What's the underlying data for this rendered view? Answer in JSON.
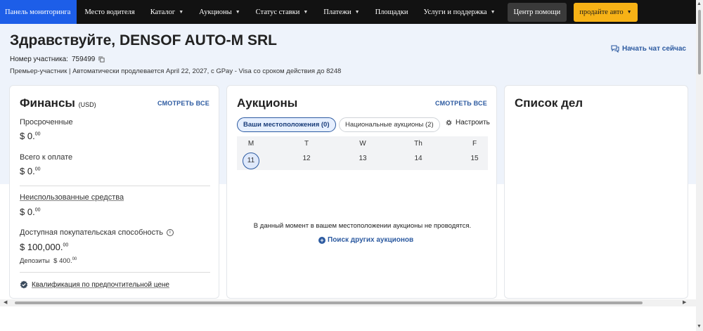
{
  "nav": {
    "items": [
      {
        "label": "Панель мониторинга",
        "active": true,
        "dropdown": false
      },
      {
        "label": "Место водителя",
        "active": false,
        "dropdown": false
      },
      {
        "label": "Каталог",
        "active": false,
        "dropdown": true
      },
      {
        "label": "Аукционы",
        "active": false,
        "dropdown": true
      },
      {
        "label": "Статус ставки",
        "active": false,
        "dropdown": true
      },
      {
        "label": "Платежи",
        "active": false,
        "dropdown": true
      },
      {
        "label": "Площадки",
        "active": false,
        "dropdown": false
      },
      {
        "label": "Услуги и поддержка",
        "active": false,
        "dropdown": true
      }
    ],
    "help_label": "Центр помощи",
    "sell_label": "продайте авто"
  },
  "header": {
    "greeting": "Здравствуйте, DENSOF AUTO-M SRL",
    "member_label": "Номер участника:",
    "member_number": "759499",
    "premier_line": "Премьер-участник  |  Автоматически продлевается April 22, 2027, с GPay - Visa со сроком действия до 8248",
    "chat_label": "Начать чат сейчас"
  },
  "finance": {
    "title": "Финансы",
    "currency": "(USD)",
    "see_all": "СМОТРЕТЬ ВСЕ",
    "overdue_label": "Просроченные",
    "overdue_value": "$ 0.",
    "overdue_cents": "00",
    "total_due_label": "Всего к оплате",
    "total_due_value": "$ 0.",
    "total_due_cents": "00",
    "unused_label": "Неиспользованные средства",
    "unused_value": "$ 0.",
    "unused_cents": "00",
    "buying_power_label": "Доступная покупательская способность",
    "buying_power_value": "$ 100,000.",
    "buying_power_cents": "00",
    "deposits_label": "Депозиты",
    "deposits_value": "$ 400.",
    "deposits_cents": "00",
    "qualification_label": "Квалификация по предпочтительной цене"
  },
  "auctions": {
    "title": "Аукционы",
    "see_all": "СМОТРЕТЬ ВСЕ",
    "tab_local": "Ваши местоположения (0)",
    "tab_national": "Национальные аукционы (2)",
    "configure_label": "Настроить",
    "calendar": [
      {
        "day": "M",
        "date": "11",
        "selected": true
      },
      {
        "day": "T",
        "date": "12",
        "selected": false
      },
      {
        "day": "W",
        "date": "13",
        "selected": false
      },
      {
        "day": "Th",
        "date": "14",
        "selected": false
      },
      {
        "day": "F",
        "date": "15",
        "selected": false
      }
    ],
    "empty_message": "В данный момент в вашем местоположении аукционы не проводятся.",
    "search_more_label": "Поиск других аукционов"
  },
  "todo": {
    "title": "Список дел"
  },
  "colors": {
    "nav_bg": "#121212",
    "nav_active": "#1d5ee8",
    "sell_button": "#f7b216",
    "link": "#2c5aa0",
    "header_bg": "#eef3fb"
  }
}
